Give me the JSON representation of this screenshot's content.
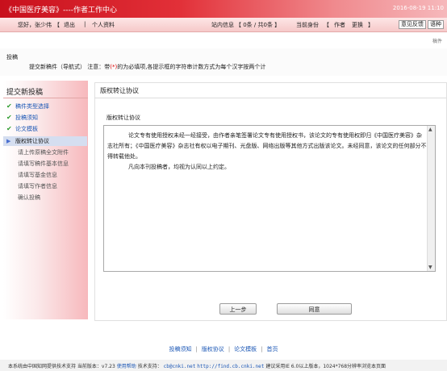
{
  "header": {
    "title": "《中国医疗美容》----作者工作中心",
    "datetime": "2016-08-19 11:10"
  },
  "userbar": {
    "greeting": "您好，张少伟",
    "logout_open": "【",
    "logout": "退出",
    "sep1": "|",
    "profile": "个人资料",
    "message_label": "站内信息",
    "message_count": "【 0条 / 共0条 】",
    "role_label": "当前身份",
    "role_open": "【",
    "role": "作者",
    "switch": "更换",
    "role_close": "】",
    "feedback": "意见反馈",
    "language": "语种"
  },
  "breadcrumb_right": "稿件",
  "notice": {
    "title": "投稿",
    "prefix": "提交新稿件（导航式）",
    "note_label": "注意：带",
    "required_mark": "(*)",
    "note_rest": "的为必填项,各提示框的字符串计数方式为每个汉字按两个计"
  },
  "sidebar": {
    "title": "提交新投稿",
    "steps": [
      {
        "label": "稿件类型选择",
        "state": "done"
      },
      {
        "label": "投稿须知",
        "state": "done"
      },
      {
        "label": "论文模板",
        "state": "done"
      },
      {
        "label": "版权转让协议",
        "state": "current"
      },
      {
        "label": "请上传原稿全文附件",
        "state": "todo"
      },
      {
        "label": "请填写稿件基本信息",
        "state": "todo"
      },
      {
        "label": "请填写基金信息",
        "state": "todo"
      },
      {
        "label": "请填写作者信息",
        "state": "todo"
      },
      {
        "label": "确认投稿",
        "state": "todo"
      }
    ]
  },
  "main": {
    "title": "版权转让协议",
    "subtitle": "版权转让协议",
    "paragraph1": "论文专有使用授权未经一经接受，由作者亲笔签署论文专有使用授权书，该论文的专有使用权即归《中国医疗美容》杂志社所有；《中国医疗美容》杂志社有权以电子期刊、光盘版、网络出版等其他方式出版该论文。未经同意，该论文的任何部分不得转载他处。",
    "paragraph2": "凡向本刊投稿者，均视为认同以上约定。",
    "prev_button": "上一步",
    "agree_button": "同意"
  },
  "footer": {
    "links": [
      "投稿须知",
      "版权协议",
      "论文模板",
      "首页"
    ],
    "support_text": "本系统由中国知网提供技术支持 当前版本：v7.23",
    "help": "使用帮助",
    "tech_label": "技术支持：",
    "email": "cb@cnki.net",
    "url": "http://find.cb.cnki.net",
    "browser_note": "建议采用IE 6.0以上版本，1024*768分辨率浏览本页面"
  }
}
